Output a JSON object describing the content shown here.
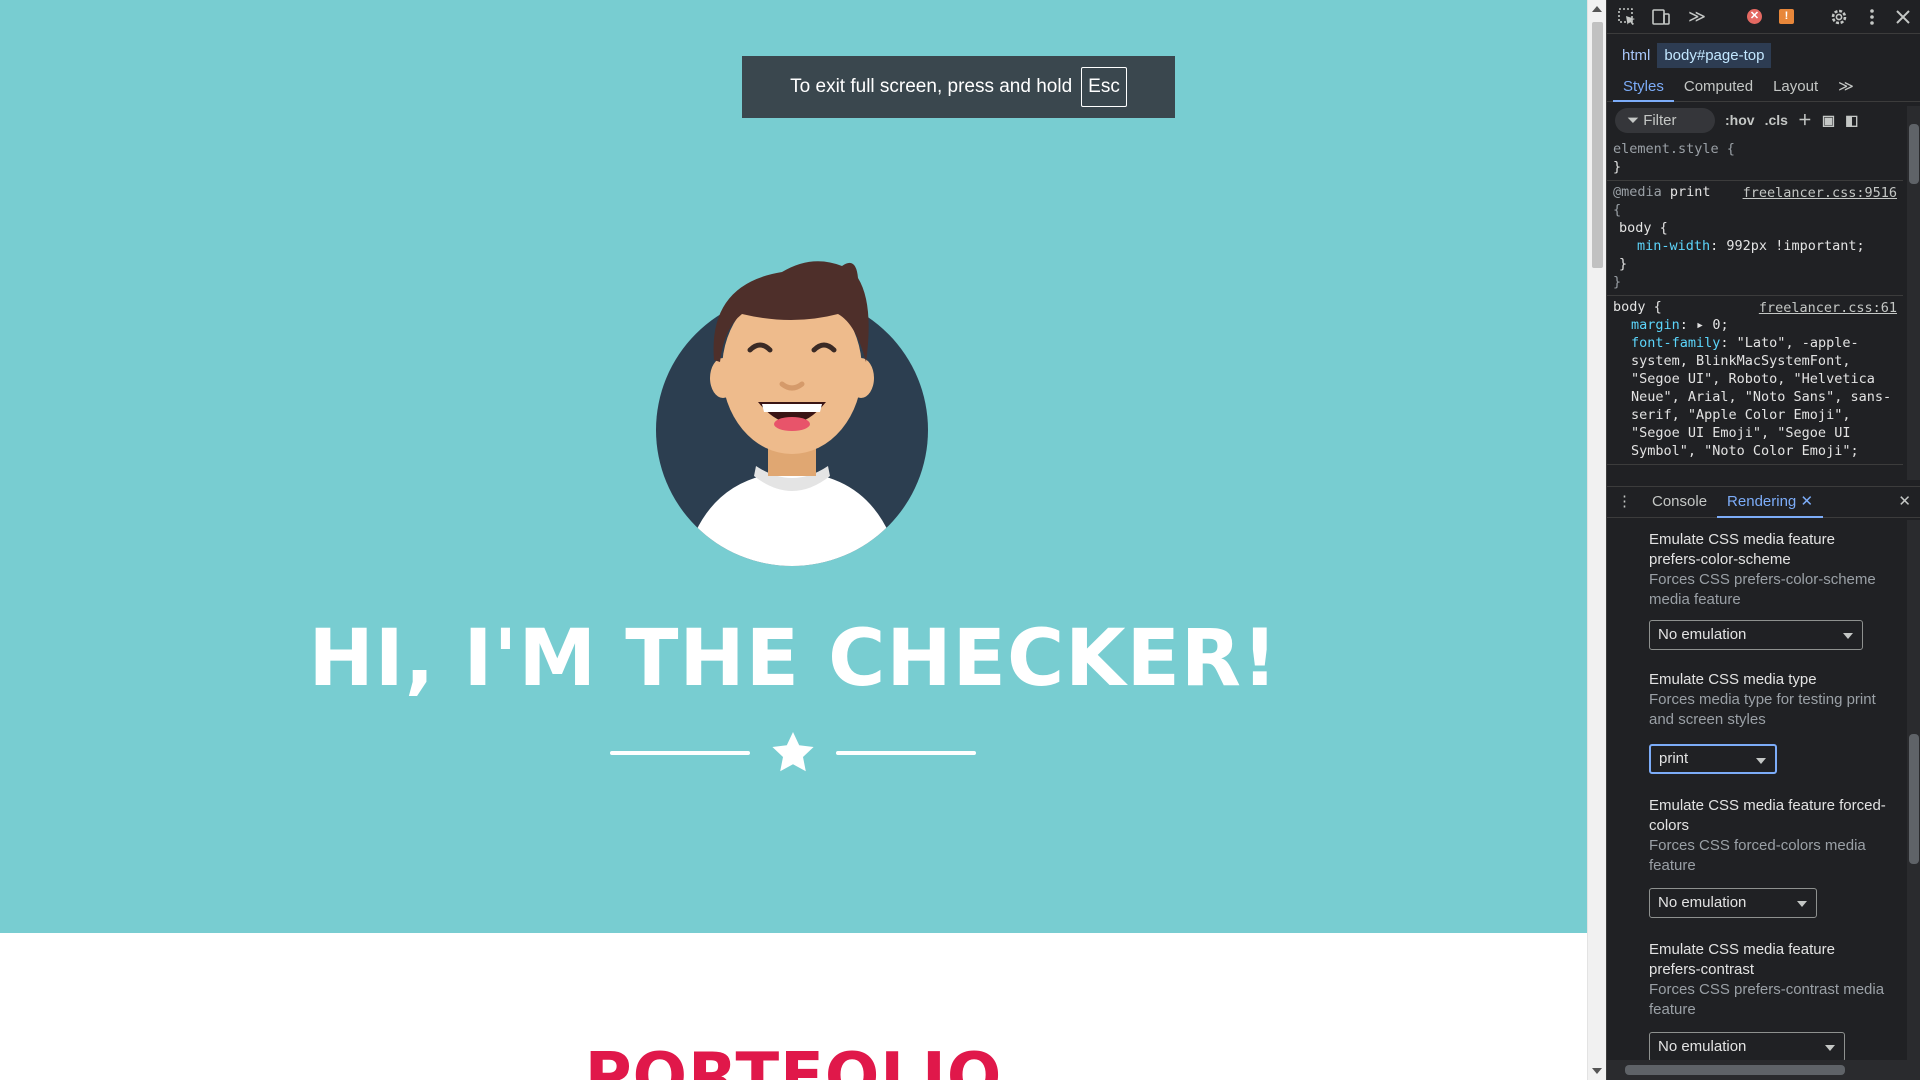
{
  "page": {
    "fullscreen_notice": "To exit full screen, press and hold",
    "fullscreen_key": "Esc",
    "hero_title": "HI, I'M THE CHECKER!",
    "portfolio_heading": "PORTFOLIO",
    "colors": {
      "masthead": "#78cdd1",
      "portfolio": "#e0184a"
    }
  },
  "devtools": {
    "toolbar": {
      "icons": [
        "inspect-element-icon",
        "device-toolbar-icon",
        "more-tabs-icon",
        "settings-icon",
        "kebab-menu-icon",
        "close-icon"
      ],
      "more_tabs": "≫"
    },
    "breadcrumbs": [
      "html",
      "body#page-top"
    ],
    "tabs": [
      "Styles",
      "Computed",
      "Layout"
    ],
    "filter": {
      "label": "Filter",
      "hov": ":hov",
      "cls": ".cls"
    },
    "styles": {
      "element_style": "element.style {",
      "close_brace": "}",
      "media_at": "@media",
      "media_type": "print",
      "media_source": "freelancer.css:9516",
      "open_brace": "{",
      "body_selector": "body {",
      "min_width_prop": "min-width",
      "min_width_val": "992px !important;",
      "body_source": "freelancer.css:61",
      "margin_prop": "margin",
      "margin_val": "0;",
      "font_family_prop": "font-family",
      "font_family_val": "\"Lato\", -apple-system, BlinkMacSystemFont, \"Segoe UI\", Roboto, \"Helvetica Neue\", Arial, \"Noto Sans\", sans-serif, \"Apple Color Emoji\", \"Segoe UI Emoji\", \"Segoe UI Symbol\", \"Noto Color Emoji\";"
    },
    "drawer": {
      "tabs": [
        "Console",
        "Rendering"
      ],
      "sections": [
        {
          "title": "Emulate CSS media feature prefers-color-scheme",
          "desc": "Forces CSS prefers-color-scheme media feature",
          "value": "No emulation"
        },
        {
          "title": "Emulate CSS media type",
          "desc": "Forces media type for testing print and screen styles",
          "value": "print"
        },
        {
          "title": "Emulate CSS media feature forced-colors",
          "desc": "Forces CSS forced-colors media feature",
          "value": "No emulation"
        },
        {
          "title": "Emulate CSS media feature prefers-contrast",
          "desc": "Forces CSS prefers-contrast media feature",
          "value": "No emulation"
        }
      ]
    }
  }
}
